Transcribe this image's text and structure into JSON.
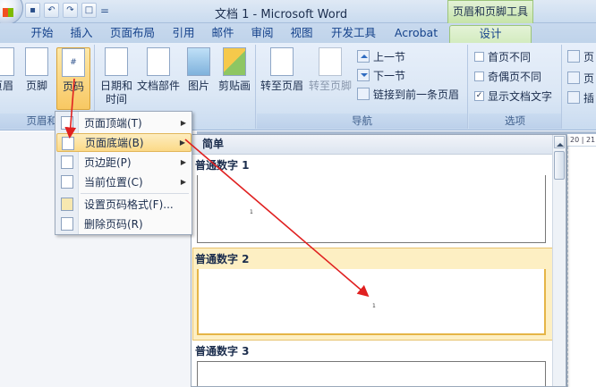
{
  "window": {
    "title": "文档 1 - Microsoft Word",
    "context_tab_group": "页眉和页脚工具"
  },
  "qat": {
    "undo_label": "↶",
    "redo_label": "↷",
    "customize_label": "="
  },
  "tabs": [
    {
      "label": "开始"
    },
    {
      "label": "插入"
    },
    {
      "label": "页面布局"
    },
    {
      "label": "引用"
    },
    {
      "label": "邮件"
    },
    {
      "label": "审阅"
    },
    {
      "label": "视图"
    },
    {
      "label": "开发工具"
    },
    {
      "label": "Acrobat"
    },
    {
      "label": "设计",
      "active": true
    }
  ],
  "ribbon": {
    "group_header_footer": {
      "label": "页眉和页",
      "buttons": [
        "页眉",
        "页脚",
        "页码"
      ]
    },
    "group_insert": {
      "buttons": [
        "日期和时间",
        "文档部件",
        "图片",
        "剪贴画"
      ],
      "date_line1": "日期和",
      "date_line2": "时间"
    },
    "group_nav": {
      "label": "导航",
      "goto_header": "转至页眉",
      "goto_footer": "转至页脚",
      "prev_section": "上一节",
      "next_section": "下一节",
      "link_previous": "链接到前一条页眉"
    },
    "group_options": {
      "label": "选项",
      "diff_first": "首页不同",
      "diff_odd_even": "奇偶页不同",
      "show_doc_text": "显示文档文字",
      "show_doc_text_checked": true
    },
    "group_position": {
      "items": [
        "页",
        "页",
        "插"
      ]
    }
  },
  "page_number_menu": {
    "items": [
      {
        "label": "页面顶端(T)",
        "submenu": true
      },
      {
        "label": "页面底端(B)",
        "submenu": true,
        "highlighted": true
      },
      {
        "label": "页边距(P)",
        "submenu": true
      },
      {
        "label": "当前位置(C)",
        "submenu": true
      },
      {
        "label": "设置页码格式(F)...",
        "submenu": false
      },
      {
        "label": "删除页码(R)",
        "submenu": false
      }
    ]
  },
  "gallery": {
    "header": "简单",
    "items": [
      {
        "title": "普通数字 1",
        "page_number": "1"
      },
      {
        "title": "普通数字 2",
        "page_number": "1",
        "highlighted": true
      },
      {
        "title": "普通数字 3"
      }
    ]
  },
  "ruler": {
    "text": "20 | 21"
  },
  "colors": {
    "accent_red": "#e02020",
    "highlight": "#fbd987",
    "ribbon_blue": "#dbe7f5"
  }
}
